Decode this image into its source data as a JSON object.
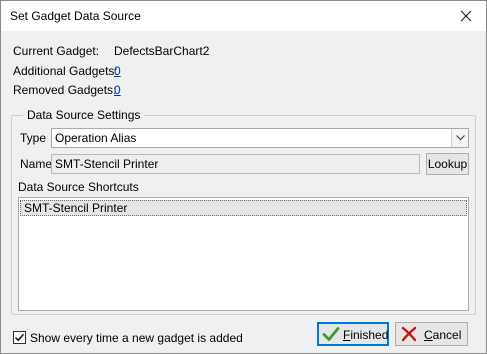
{
  "window": {
    "title": "Set Gadget Data Source"
  },
  "info": {
    "current_gadget_label": "Current Gadget:",
    "current_gadget_value": "DefectsBarChart2",
    "additional_gadgets_label": "Additional Gadgets:",
    "additional_gadgets_value": "0",
    "removed_gadgets_label": "Removed Gadgets:",
    "removed_gadgets_value": "0"
  },
  "settings": {
    "group_title": "Data Source Settings",
    "type_label": "Type",
    "type_value": "Operation Alias",
    "name_label": "Name",
    "name_value": "SMT-Stencil Printer",
    "lookup_label": "Lookup",
    "shortcuts_label": "Data Source Shortcuts",
    "shortcuts": [
      "SMT-Stencil Printer"
    ]
  },
  "footer": {
    "show_every_time_label": "Show every time a new gadget is added",
    "show_every_time_checked": true,
    "finished_label": "Finished",
    "cancel_label": "Cancel"
  },
  "colors": {
    "link": "#0033aa",
    "finished_check": "#3c9a2f",
    "cancel_x": "#cc1010",
    "default_button_border": "#0078d7"
  }
}
